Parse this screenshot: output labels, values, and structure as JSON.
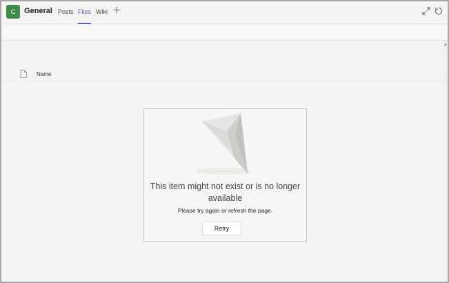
{
  "header": {
    "team_initial": "C",
    "channel_name": "General",
    "tabs": [
      {
        "label": "Posts",
        "active": false
      },
      {
        "label": "Files",
        "active": true
      },
      {
        "label": "Wiki",
        "active": false
      }
    ],
    "add_tab_icon": "plus-icon",
    "icons": [
      "expand-icon",
      "refresh-icon"
    ]
  },
  "file_list": {
    "columns": [
      {
        "label": "Name",
        "icon": "document-icon"
      }
    ]
  },
  "error": {
    "title": "This item might not exist or is no longer available",
    "subtitle": "Please try again or refresh the page.",
    "retry_label": "Retry",
    "illustration": "paper-plane-illustration"
  },
  "colors": {
    "accent": "#5b5fc7",
    "team_avatar": "#3f8c4a",
    "background": "#f5f4f2"
  }
}
